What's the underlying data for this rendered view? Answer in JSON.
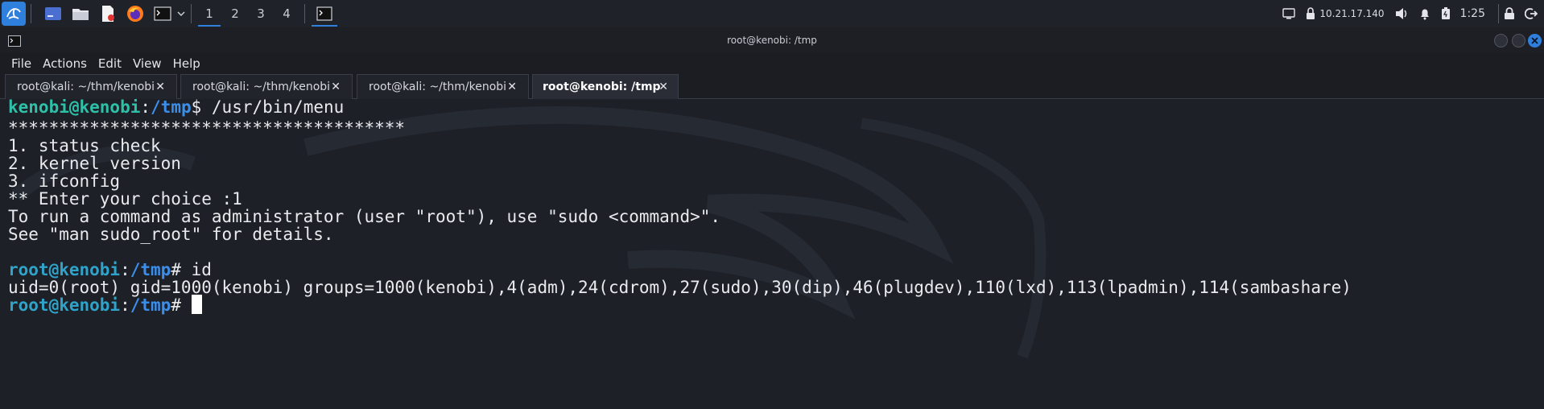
{
  "taskbar": {
    "workspaces": [
      "1",
      "2",
      "3",
      "4"
    ],
    "ip": "10.21.17.140",
    "clock": "1:25"
  },
  "window": {
    "title": "root@kenobi: /tmp"
  },
  "menu": [
    "File",
    "Actions",
    "Edit",
    "View",
    "Help"
  ],
  "tabs": [
    {
      "label": "root@kali: ~/thm/kenobi",
      "close": "✕"
    },
    {
      "label": "root@kali: ~/thm/kenobi",
      "close": "✕"
    },
    {
      "label": "root@kali: ~/thm/kenobi",
      "close": "✕"
    },
    {
      "label": "root@kenobi: /tmp",
      "close": "✕"
    }
  ],
  "terminal": {
    "prompt1": {
      "user": "kenobi@kenobi",
      "colon": ":",
      "path": "/tmp",
      "sym": "$",
      "cmd": " /usr/bin/menu"
    },
    "output1": [
      "***************************************",
      "1. status check",
      "2. kernel version",
      "3. ifconfig",
      "** Enter your choice :1",
      "To run a command as administrator (user \"root\"), use \"sudo <command>\".",
      "See \"man sudo_root\" for details."
    ],
    "prompt2": {
      "user": "root@kenobi",
      "colon": ":",
      "path": "/tmp",
      "sym": "#",
      "cmd": " id"
    },
    "output2": "uid=0(root) gid=1000(kenobi) groups=1000(kenobi),4(adm),24(cdrom),27(sudo),30(dip),46(plugdev),110(lxd),113(lpadmin),114(sambashare)",
    "prompt3": {
      "user": "root@kenobi",
      "colon": ":",
      "path": "/tmp",
      "sym": "# ",
      "cmd": ""
    }
  },
  "colors": {
    "accent": "#2f7fdc",
    "prompt_teal": "#2ec0a8",
    "prompt_path": "#3b8eea",
    "close_button": "#2f7fdc"
  }
}
